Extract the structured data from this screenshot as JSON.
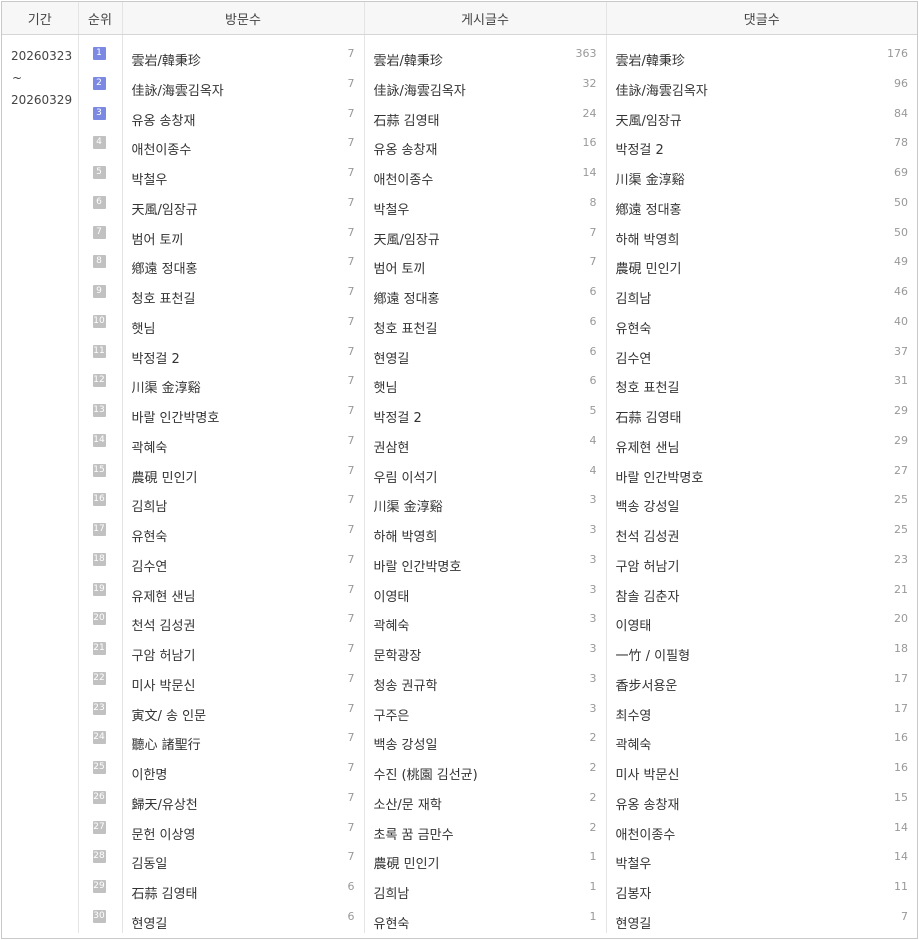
{
  "headers": {
    "period": "기간",
    "rank": "순위",
    "visits": "방문수",
    "posts": "게시글수",
    "comments": "댓글수"
  },
  "period": {
    "start": "20260323",
    "tilde": "~",
    "end": "20260329"
  },
  "colors": {
    "badge_top": "#7b89e3",
    "badge_default": "#c1c1c1"
  },
  "ranks": [
    "1",
    "2",
    "3",
    "4",
    "5",
    "6",
    "7",
    "8",
    "9",
    "10",
    "11",
    "12",
    "13",
    "14",
    "15",
    "16",
    "17",
    "18",
    "19",
    "20",
    "21",
    "22",
    "23",
    "24",
    "25",
    "26",
    "27",
    "28",
    "29",
    "30"
  ],
  "visits": [
    {
      "name": "雲岩/韓秉珍",
      "count": "7"
    },
    {
      "name": "佳詠/海雲김옥자",
      "count": "7"
    },
    {
      "name": "유옹 송창재",
      "count": "7"
    },
    {
      "name": "애천이종수",
      "count": "7"
    },
    {
      "name": "박철우",
      "count": "7"
    },
    {
      "name": "天風/임장규",
      "count": "7"
    },
    {
      "name": "범어 토끼",
      "count": "7"
    },
    {
      "name": "鄕遠 정대홍",
      "count": "7"
    },
    {
      "name": "청호 표천길",
      "count": "7"
    },
    {
      "name": "햇님",
      "count": "7"
    },
    {
      "name": "박정걸 2",
      "count": "7"
    },
    {
      "name": "川渠 金淳谿",
      "count": "7"
    },
    {
      "name": "바랄 인간박명호",
      "count": "7"
    },
    {
      "name": "곽혜숙",
      "count": "7"
    },
    {
      "name": "農硯 민인기",
      "count": "7"
    },
    {
      "name": "김희남",
      "count": "7"
    },
    {
      "name": "유현숙",
      "count": "7"
    },
    {
      "name": "김수연",
      "count": "7"
    },
    {
      "name": "유제현 샌님",
      "count": "7"
    },
    {
      "name": "천석 김성권",
      "count": "7"
    },
    {
      "name": "구암 허남기",
      "count": "7"
    },
    {
      "name": "미사 박문신",
      "count": "7"
    },
    {
      "name": "寅文/ 송 인문",
      "count": "7"
    },
    {
      "name": "聽心 諸聖行",
      "count": "7"
    },
    {
      "name": "이한명",
      "count": "7"
    },
    {
      "name": "歸天/유상천",
      "count": "7"
    },
    {
      "name": "문헌 이상영",
      "count": "7"
    },
    {
      "name": "김동일",
      "count": "7"
    },
    {
      "name": "石蒜 김영태",
      "count": "6"
    },
    {
      "name": "현영길",
      "count": "6"
    }
  ],
  "posts": [
    {
      "name": "雲岩/韓秉珍",
      "count": "363"
    },
    {
      "name": "佳詠/海雲김옥자",
      "count": "32"
    },
    {
      "name": "石蒜 김영태",
      "count": "24"
    },
    {
      "name": "유옹 송창재",
      "count": "16"
    },
    {
      "name": "애천이종수",
      "count": "14"
    },
    {
      "name": "박철우",
      "count": "8"
    },
    {
      "name": "天風/임장규",
      "count": "7"
    },
    {
      "name": "범어 토끼",
      "count": "7"
    },
    {
      "name": "鄕遠 정대홍",
      "count": "6"
    },
    {
      "name": "청호 표천길",
      "count": "6"
    },
    {
      "name": "현영길",
      "count": "6"
    },
    {
      "name": "햇님",
      "count": "6"
    },
    {
      "name": "박정걸 2",
      "count": "5"
    },
    {
      "name": "권삼현",
      "count": "4"
    },
    {
      "name": "우림 이석기",
      "count": "4"
    },
    {
      "name": "川渠 金淳谿",
      "count": "3"
    },
    {
      "name": "하해 박영희",
      "count": "3"
    },
    {
      "name": "바랄 인간박명호",
      "count": "3"
    },
    {
      "name": "이영태",
      "count": "3"
    },
    {
      "name": "곽혜숙",
      "count": "3"
    },
    {
      "name": "문학광장",
      "count": "3"
    },
    {
      "name": "청송 권규학",
      "count": "3"
    },
    {
      "name": "구주은",
      "count": "3"
    },
    {
      "name": "백송 강성일",
      "count": "2"
    },
    {
      "name": "수진 (桃園 김선균)",
      "count": "2"
    },
    {
      "name": "소산/문 재학",
      "count": "2"
    },
    {
      "name": "초록 꿈 금만수",
      "count": "2"
    },
    {
      "name": "農硯 민인기",
      "count": "1"
    },
    {
      "name": "김희남",
      "count": "1"
    },
    {
      "name": "유현숙",
      "count": "1"
    }
  ],
  "comments": [
    {
      "name": "雲岩/韓秉珍",
      "count": "176"
    },
    {
      "name": "佳詠/海雲김옥자",
      "count": "96"
    },
    {
      "name": "天風/임장규",
      "count": "84"
    },
    {
      "name": "박정걸 2",
      "count": "78"
    },
    {
      "name": "川渠 金淳谿",
      "count": "69"
    },
    {
      "name": "鄕遠 정대홍",
      "count": "50"
    },
    {
      "name": "하해 박영희",
      "count": "50"
    },
    {
      "name": "農硯 민인기",
      "count": "49"
    },
    {
      "name": "김희남",
      "count": "46"
    },
    {
      "name": "유현숙",
      "count": "40"
    },
    {
      "name": "김수연",
      "count": "37"
    },
    {
      "name": "청호 표천길",
      "count": "31"
    },
    {
      "name": "石蒜 김영태",
      "count": "29"
    },
    {
      "name": "유제현 샌님",
      "count": "29"
    },
    {
      "name": "바랄 인간박명호",
      "count": "27"
    },
    {
      "name": "백송 강성일",
      "count": "25"
    },
    {
      "name": "천석 김성권",
      "count": "25"
    },
    {
      "name": "구암 허남기",
      "count": "23"
    },
    {
      "name": "참솔 김춘자",
      "count": "21"
    },
    {
      "name": "이영태",
      "count": "20"
    },
    {
      "name": "一竹 / 이필형",
      "count": "18"
    },
    {
      "name": "香步서용운",
      "count": "17"
    },
    {
      "name": "최수영",
      "count": "17"
    },
    {
      "name": "곽혜숙",
      "count": "16"
    },
    {
      "name": "미사 박문신",
      "count": "16"
    },
    {
      "name": "유옹 송창재",
      "count": "15"
    },
    {
      "name": "애천이종수",
      "count": "14"
    },
    {
      "name": "박철우",
      "count": "14"
    },
    {
      "name": "김봉자",
      "count": "11"
    },
    {
      "name": "현영길",
      "count": "7"
    }
  ]
}
